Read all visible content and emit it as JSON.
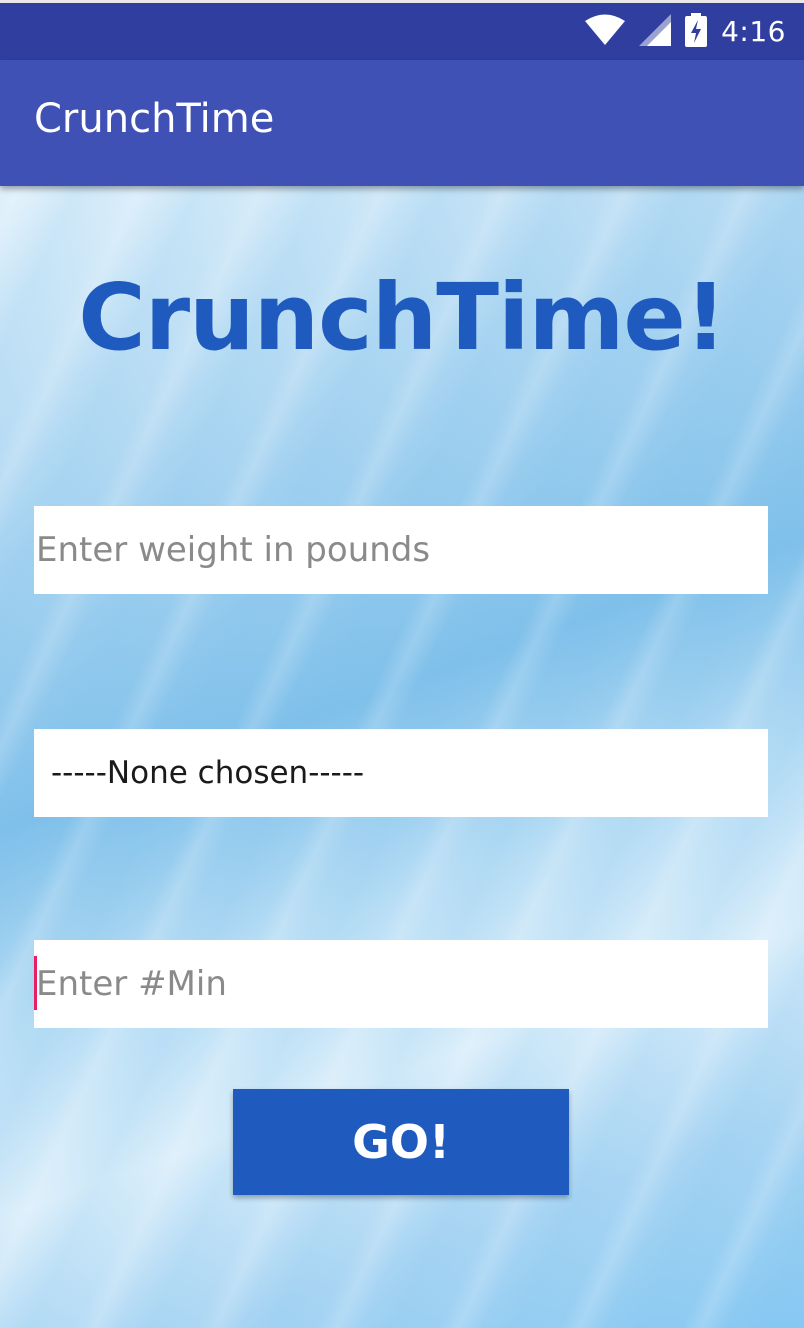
{
  "status_bar": {
    "time": "4:16",
    "icons": [
      "wifi-icon",
      "cell-signal-icon",
      "battery-charging-icon"
    ],
    "background_color": "#303f9f"
  },
  "app_bar": {
    "title": "CrunchTime",
    "background_color": "#3f51b5"
  },
  "main": {
    "hero_title": "CrunchTime!",
    "hero_color": "#1f5bbf",
    "weight_input": {
      "value": "",
      "placeholder": "Enter weight in pounds"
    },
    "exercise_spinner": {
      "selected": "-----None chosen-----"
    },
    "minutes_input": {
      "value": "",
      "placeholder": "Enter #Min"
    },
    "go_button": {
      "label": "GO!",
      "background_color": "#1f5bbf"
    },
    "cursor_color": "#e91e63"
  }
}
